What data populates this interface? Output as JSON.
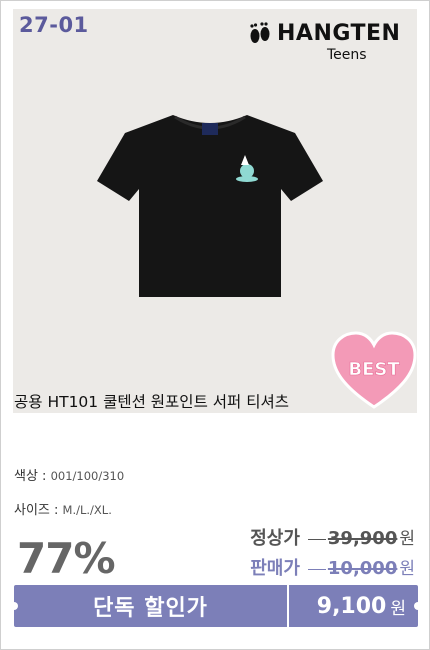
{
  "product": {
    "code": "27-01",
    "brand": "HANGTEN",
    "brand_sub": "Teens",
    "badge": "BEST",
    "name": "공용 HT101 쿨텐션 원포인트 서퍼 티셔츠"
  },
  "options": {
    "color_label": "색상 : ",
    "color_value": "001/100/310",
    "size_label": "사이즈 : ",
    "size_value": "M./L./XL."
  },
  "pricing": {
    "discount": "77%",
    "regular_label": "정상가",
    "regular_price": "39,900",
    "sale_label": "판매가",
    "sale_price": "10,000",
    "currency": "원",
    "exclusive_label": "단독 할인가",
    "exclusive_price": "9,100"
  },
  "colors": {
    "accent": "#7c7fb8",
    "code_text": "#5b5a9c",
    "badge_pink": "#f39ab7",
    "shirt": "#151515",
    "photo_bg": "#eceae7"
  }
}
